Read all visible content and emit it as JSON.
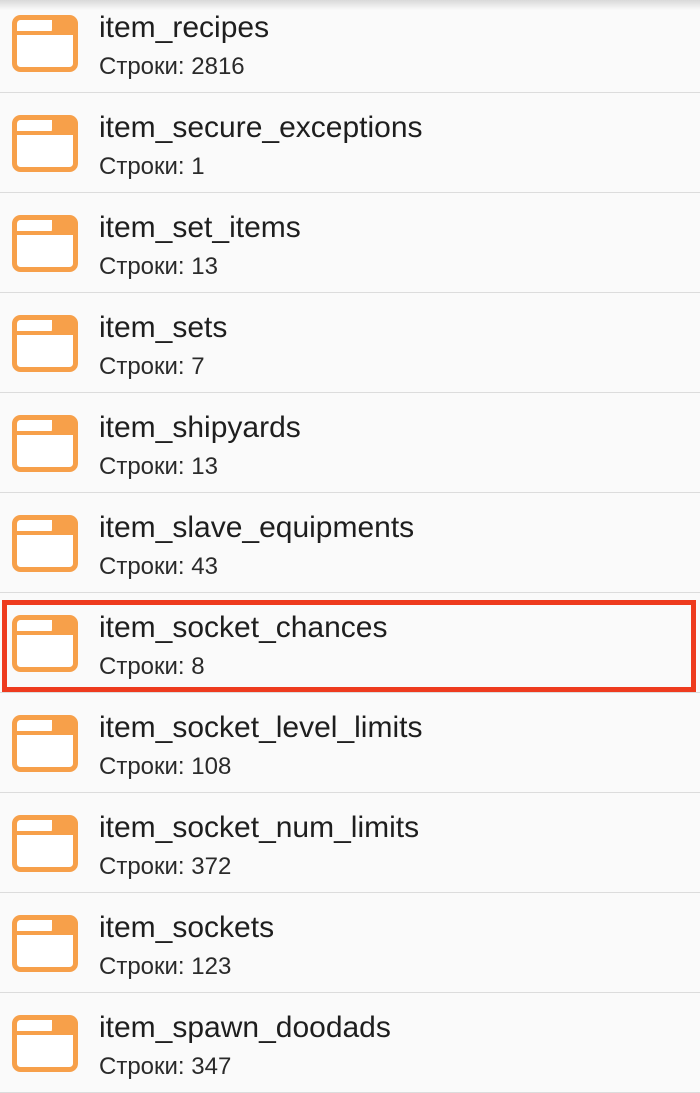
{
  "rows_prefix": "Строки:",
  "accent_color": "#f7a04a",
  "highlight_color": "#ee3b1e",
  "items": [
    {
      "name": "item_recipes",
      "rows": "Строки: 2816",
      "icon": "folder-icon"
    },
    {
      "name": "item_secure_exceptions",
      "rows": "Строки: 1",
      "icon": "folder-icon"
    },
    {
      "name": "item_set_items",
      "rows": "Строки: 13",
      "icon": "folder-icon"
    },
    {
      "name": "item_sets",
      "rows": "Строки: 7",
      "icon": "folder-icon"
    },
    {
      "name": "item_shipyards",
      "rows": "Строки: 13",
      "icon": "folder-icon"
    },
    {
      "name": "item_slave_equipments",
      "rows": "Строки: 43",
      "icon": "folder-icon"
    },
    {
      "name": "item_socket_chances",
      "rows": "Строки: 8",
      "icon": "folder-icon",
      "highlighted": true
    },
    {
      "name": "item_socket_level_limits",
      "rows": "Строки: 108",
      "icon": "folder-icon"
    },
    {
      "name": "item_socket_num_limits",
      "rows": "Строки: 372",
      "icon": "folder-icon"
    },
    {
      "name": "item_sockets",
      "rows": "Строки: 123",
      "icon": "folder-icon"
    },
    {
      "name": "item_spawn_doodads",
      "rows": "Строки: 347",
      "icon": "folder-icon"
    }
  ]
}
